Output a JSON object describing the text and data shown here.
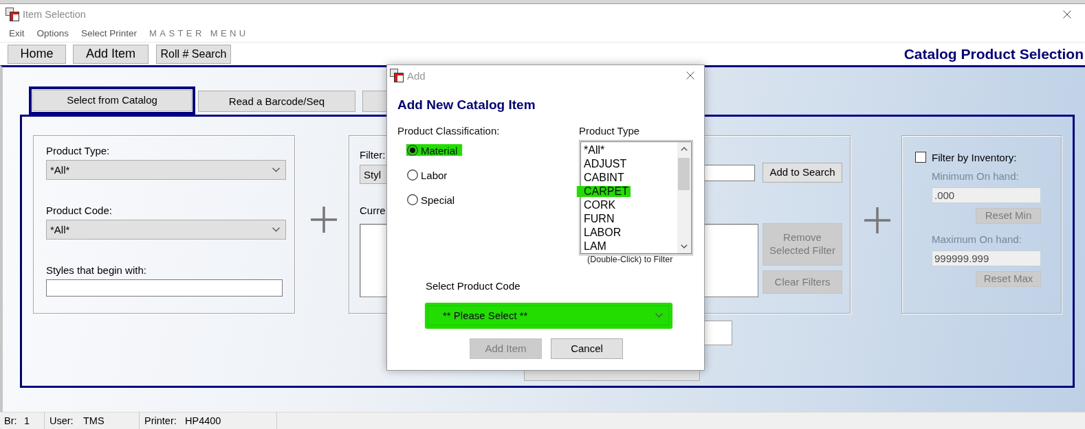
{
  "window": {
    "title": "Item Selection"
  },
  "menu": [
    {
      "label": "Exit"
    },
    {
      "label": "Options"
    },
    {
      "label": "Select Printer"
    }
  ],
  "menu_banner": "MASTER MENU",
  "toolbar": {
    "buttons": [
      "Home",
      "Add Item",
      "Roll # Search"
    ],
    "page_title": "Catalog Product Selection"
  },
  "tabs": [
    {
      "label": "Select from Catalog",
      "selected": true
    },
    {
      "label": "Read a Barcode/Seq",
      "selected": false
    }
  ],
  "product_box": {
    "fields": [
      {
        "kind": "select",
        "label": "Product Type:",
        "value": "*All*"
      },
      {
        "kind": "select",
        "label": "Product Code:",
        "value": "*All*"
      },
      {
        "kind": "text",
        "label": "Styles that begin with:"
      }
    ]
  },
  "filter_box": {
    "filter_label": "Filter:",
    "filter_value": "Styl",
    "current_label": "Curre",
    "buttons": [
      {
        "label": "Add to Search",
        "disabled": false
      },
      {
        "label": "Remove Selected Filter",
        "disabled": true
      },
      {
        "label": "Clear Filters",
        "disabled": true
      }
    ]
  },
  "inventory_box": {
    "checkbox": {
      "label": "Filter by Inventory:",
      "checked": false
    },
    "disabled": true,
    "fields": [
      {
        "label": "Minimum On hand:",
        "value": ".000",
        "button": "Reset Min"
      },
      {
        "label": "Maximum On hand:",
        "value": "999999.999",
        "button": "Reset Max"
      }
    ]
  },
  "dialog": {
    "title": "Add",
    "heading": "Add New Catalog Item",
    "classification_label": "Product Classification:",
    "classifications": [
      {
        "label": "Material",
        "selected": true,
        "highlighted": true
      },
      {
        "label": "Labor",
        "selected": false,
        "highlighted": false
      },
      {
        "label": "Special",
        "selected": false,
        "highlighted": false
      }
    ],
    "type_label": "Product Type",
    "types": [
      {
        "label": "*All*",
        "highlighted": false
      },
      {
        "label": "ADJUST",
        "highlighted": false
      },
      {
        "label": "CABINT",
        "highlighted": false
      },
      {
        "label": "CARPET",
        "highlighted": true
      },
      {
        "label": "CORK",
        "highlighted": false
      },
      {
        "label": "FURN",
        "highlighted": false
      },
      {
        "label": "LABOR",
        "highlighted": false
      },
      {
        "label": "LAM",
        "highlighted": false
      }
    ],
    "type_hint": "(Double-Click) to Filter",
    "code_label": "Select Product Code",
    "code_select": {
      "value": "** Please Select **",
      "highlighted": true
    },
    "buttons": [
      {
        "label": "Add Item",
        "disabled": true
      },
      {
        "label": "Cancel",
        "disabled": false
      }
    ]
  },
  "status_bar": [
    {
      "label": "Br:",
      "value": "1"
    },
    {
      "label": "User:",
      "value": "TMS"
    },
    {
      "label": "Printer:",
      "value": "HP4400"
    }
  ]
}
